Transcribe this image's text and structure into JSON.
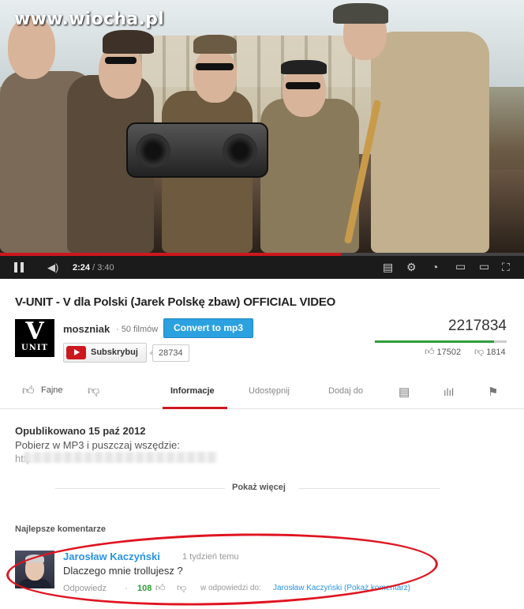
{
  "watermark": "www.wiocha.pl",
  "player": {
    "current_time": "2:24",
    "total_time": " / 3:40",
    "progress": 0.65,
    "icons": [
      "pause-icon",
      "volume-icon",
      "annotations-icon",
      "settings-icon",
      "watch-later-icon",
      "small-player-icon",
      "large-player-icon",
      "fullscreen-icon"
    ]
  },
  "video": {
    "title": "V-UNIT - V dla Polski (Jarek Polskę zbaw) OFFICIAL VIDEO",
    "views": "2217834",
    "likes": "17502",
    "dislikes": "1814",
    "like_ratio": 0.906
  },
  "channel": {
    "logo_letter": "V",
    "logo_text": "UNIT",
    "name": "moszniak",
    "separator": "·",
    "films": "50 filmów",
    "convert_label": "Convert to mp3",
    "subscribe_label": "Subskrybuj",
    "subscriber_count": "28734"
  },
  "tabs": {
    "like_label": "Fajne",
    "info": "Informacje",
    "share": "Udostępnij",
    "add_to": "Dodaj do"
  },
  "description": {
    "published": "Opublikowano 15 paź 2012",
    "text": "Pobierz w MP3 i puszczaj wszędzie:",
    "url_start": "http",
    "show_more": "Pokaż więcej"
  },
  "comments": {
    "heading": "Najlepsze komentarze",
    "items": [
      {
        "author": "Jarosław Kaczyński",
        "time": "1 tydzień temu",
        "text": "Dlaczego mnie trollujesz ?",
        "reply": "Odpowiedz",
        "dot": "·",
        "likes": "108",
        "in_reply_to": "w odpowiedzi do:",
        "in_reply_link": "Jarosław Kaczyński (Pokaż komentarz)"
      }
    ]
  },
  "colors": {
    "accent_red": "#cc181e",
    "link_blue": "#2793e6",
    "like_green": "#2f9e3a",
    "convert_blue": "#2ba1e0",
    "highlight_oval": "#e01420"
  }
}
